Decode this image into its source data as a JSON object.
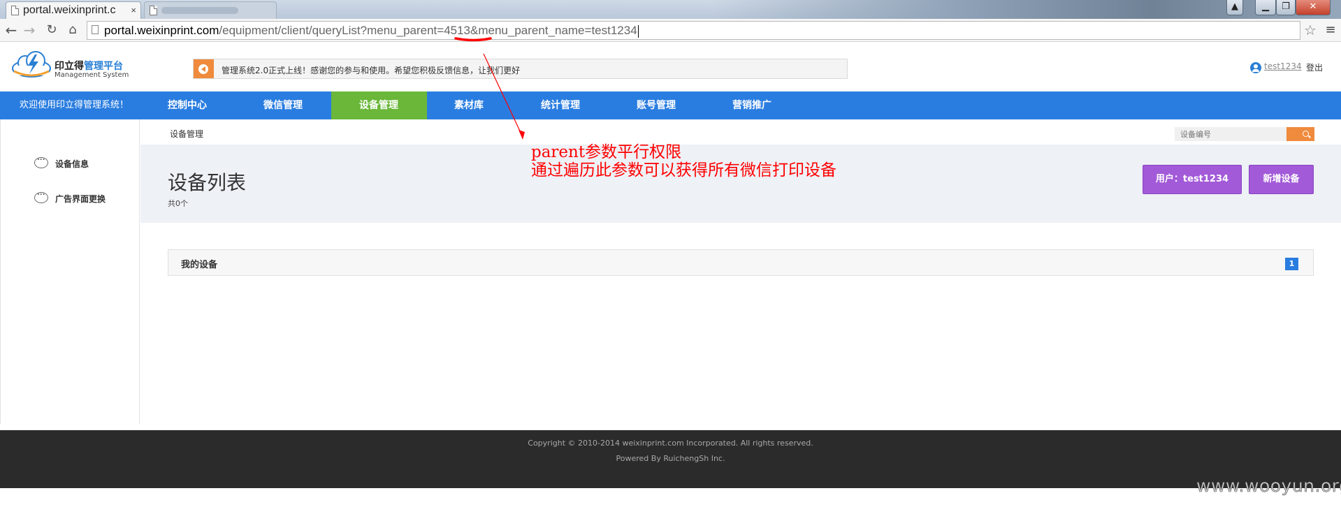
{
  "browser": {
    "active_tab_title": "portal.weixinprint.c",
    "tab_close": "×",
    "url_host": "portal.weixinprint.com",
    "url_path": "/equipment/client/queryList?menu_parent=4513&menu_parent_name=test1234",
    "icons": [
      "back-icon",
      "forward-icon",
      "reload-icon",
      "home-icon",
      "star-icon",
      "menu-icon"
    ]
  },
  "header": {
    "logo_text_prefix": "印立得",
    "logo_text_highlight": "管理平台",
    "logo_subtitle": "Management System",
    "notice_text": "管理系统2.0正式上线！感谢您的参与和使用。希望您积极反馈信息，让我们更好",
    "username": "test1234",
    "logout_label": "登出"
  },
  "nav": {
    "welcome": "欢迎使用印立得管理系统！",
    "items": [
      {
        "label": "控制中心"
      },
      {
        "label": "微信管理"
      },
      {
        "label": "设备管理"
      },
      {
        "label": "素材库"
      },
      {
        "label": "统计管理"
      },
      {
        "label": "账号管理"
      },
      {
        "label": "营销推广"
      }
    ],
    "active_index": 2
  },
  "sidebar": {
    "items": [
      {
        "label": "设备信息"
      },
      {
        "label": "广告界面更换"
      }
    ]
  },
  "content": {
    "breadcrumb": "设备管理",
    "search_placeholder": "设备编号",
    "page_title": "设备列表",
    "count_text": "共0个",
    "user_button": "用户：test1234",
    "add_button": "新增设备",
    "panel_title": "我的设备",
    "page_number": "1"
  },
  "annotation": {
    "line1": "parent参数平行权限",
    "line2": "通过遍历此参数可以获得所有微信打印设备",
    "color": "#ff0000"
  },
  "footer": {
    "copyright": "Copyright © 2010-2014 weixinprint.com Incorporated. All rights reserved.",
    "powered_by": "Powered By RuichengSh Inc."
  },
  "watermark": "www.wooyun.org",
  "colors": {
    "nav_blue": "#2a7de0",
    "nav_active_green": "#6ab73a",
    "button_purple": "#a25ad8",
    "accent_orange": "#f08a3c",
    "footer_dark": "#2b2b2b"
  }
}
